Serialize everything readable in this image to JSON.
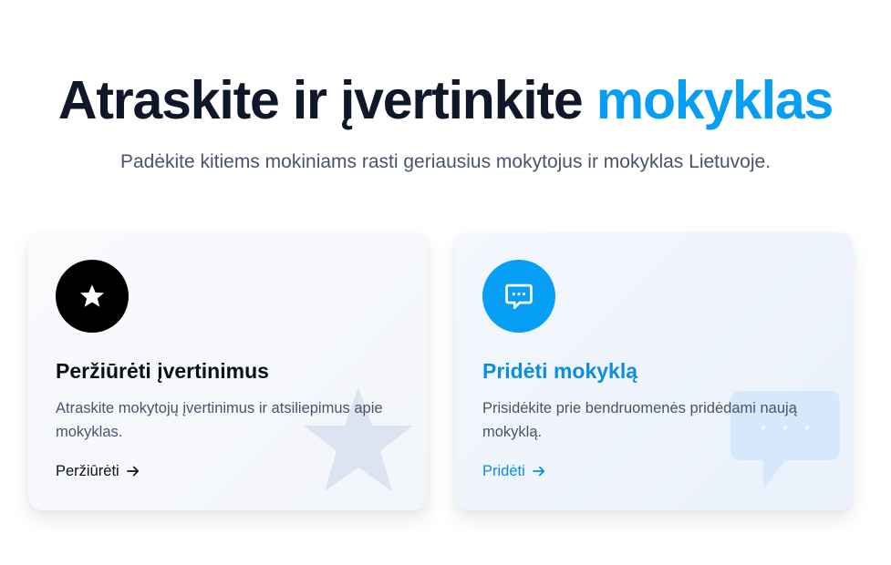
{
  "hero": {
    "title_main": "Atraskite ir įvertinkite",
    "title_accent": "mokyklas",
    "subtitle": "Padėkite kitiems mokiniams rasti geriausius mokytojus ir mokyklas Lietuvoje."
  },
  "cards": [
    {
      "icon": "star-icon",
      "title": "Peržiūrėti įvertinimus",
      "description": "Atraskite mokytojų įvertinimus ir atsiliepimus apie mokyklas.",
      "link_label": "Peržiūrėti",
      "link_icon": "arrow-right-icon",
      "background_icon": "star-icon",
      "accent_color": "#000000"
    },
    {
      "icon": "chat-bubble-icon",
      "title": "Pridėti mokyklą",
      "description": "Prisidėkite prie bendruomenės pridėdami naują mokyklą.",
      "link_label": "Pridėti",
      "link_icon": "arrow-right-icon",
      "background_icon": "chat-bubble-icon",
      "accent_color": "#079ef5"
    }
  ],
  "colors": {
    "accent": "#069ef2",
    "heading": "#0f172a",
    "body_text": "#475569"
  }
}
